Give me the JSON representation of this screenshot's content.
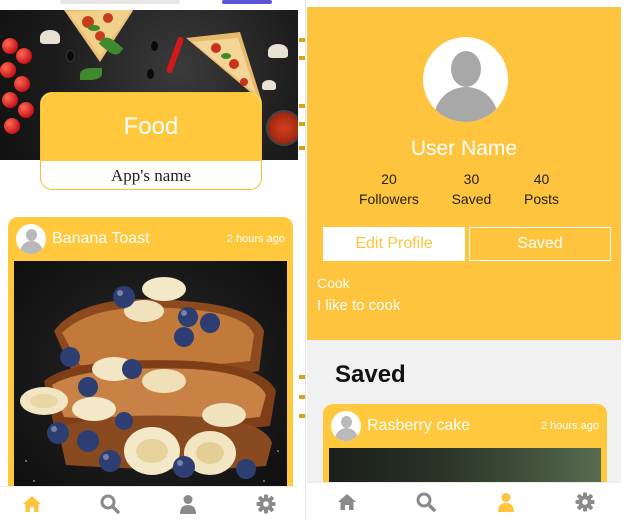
{
  "left_screen": {
    "header": {
      "app_title": "Food",
      "app_subtitle": "App's name"
    },
    "post": {
      "title": "Banana Toast",
      "time": "2 hours ago"
    },
    "nav": [
      "home",
      "search",
      "profile",
      "settings"
    ],
    "active_nav": "home"
  },
  "right_screen": {
    "profile": {
      "user_name": "User Name",
      "stats": [
        {
          "value": "20",
          "label": "Followers"
        },
        {
          "value": "30",
          "label": "Saved"
        },
        {
          "value": "40",
          "label": "Posts"
        }
      ],
      "edit_button": "Edit Profile",
      "saved_button": "Saved",
      "role": "Cook",
      "bio": "I like to cook"
    },
    "saved_section": {
      "title": "Saved",
      "post": {
        "title": "Rasberry cake",
        "time": "2 hours ago"
      }
    },
    "nav": [
      "home",
      "search",
      "profile",
      "settings"
    ],
    "active_nav": "profile"
  },
  "colors": {
    "accent": "#ffc43d",
    "inactive_icon": "#8a8a8a",
    "divider_dots": "#d9a21b"
  }
}
